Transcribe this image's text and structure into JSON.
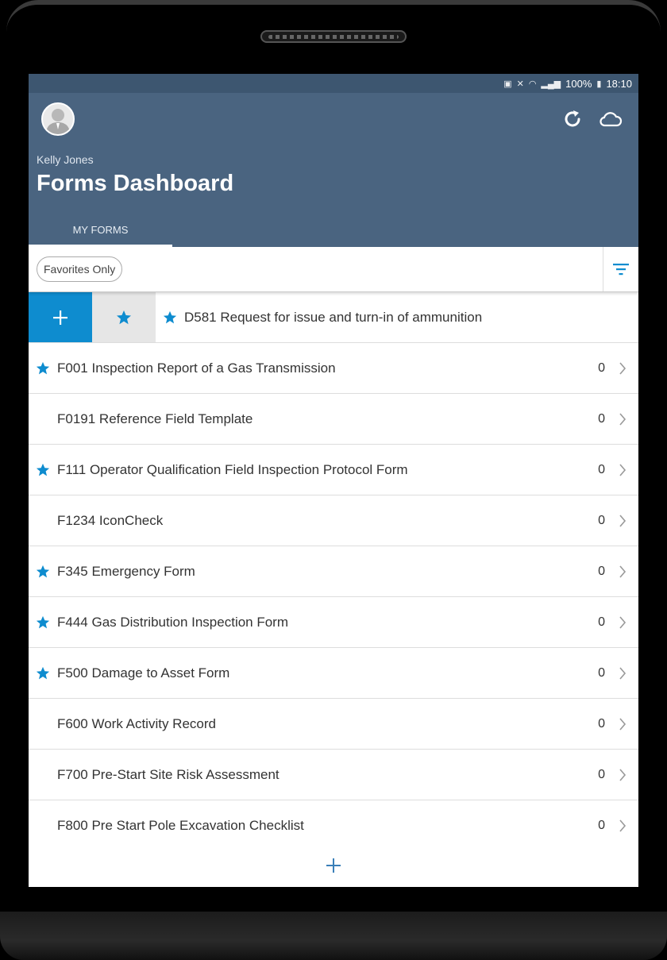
{
  "status_bar": {
    "battery": "100%",
    "time": "18:10"
  },
  "header": {
    "user_name": "Kelly Jones",
    "title": "Forms Dashboard",
    "tab": "MY FORMS"
  },
  "filter": {
    "chip_label": "Favorites Only"
  },
  "swipe_row": {
    "label": "D581 Request for issue and turn-in of ammunition",
    "favorite": true
  },
  "forms": [
    {
      "label": "F001 Inspection Report of a Gas Transmission",
      "count": "0",
      "favorite": true
    },
    {
      "label": "F0191 Reference Field Template",
      "count": "0",
      "favorite": false
    },
    {
      "label": "F111 Operator Qualification Field Inspection Protocol Form",
      "count": "0",
      "favorite": true
    },
    {
      "label": "F1234 IconCheck",
      "count": "0",
      "favorite": false
    },
    {
      "label": "F345 Emergency Form",
      "count": "0",
      "favorite": true
    },
    {
      "label": "F444 Gas Distribution Inspection Form",
      "count": "0",
      "favorite": true
    },
    {
      "label": "F500 Damage to Asset Form",
      "count": "0",
      "favorite": true
    },
    {
      "label": "F600 Work Activity Record",
      "count": "0",
      "favorite": false
    },
    {
      "label": "F700 Pre-Start Site Risk Assessment",
      "count": "0",
      "favorite": false
    },
    {
      "label": "F800 Pre Start Pole Excavation Checklist",
      "count": "0",
      "favorite": false
    }
  ],
  "colors": {
    "accent": "#0e8ccf",
    "header": "#4a6480",
    "status_bar": "#3d5670"
  },
  "icons": [
    "refresh-icon",
    "cloud-icon",
    "filter-icon",
    "star-icon",
    "plus-icon",
    "chevron-right-icon"
  ]
}
